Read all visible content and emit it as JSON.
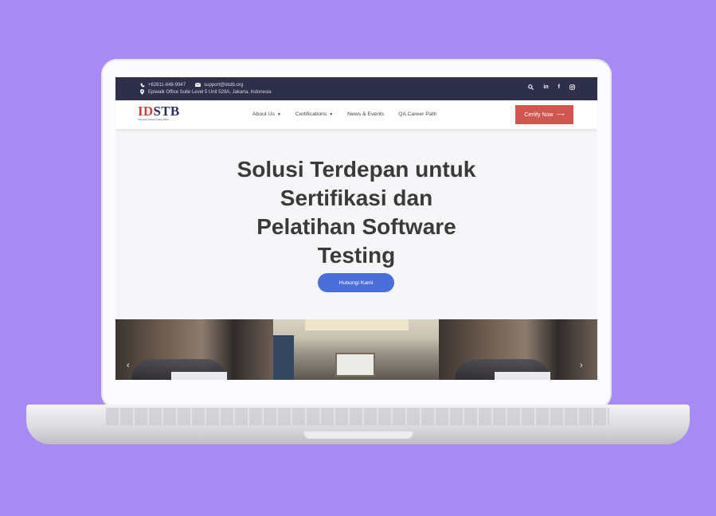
{
  "topbar": {
    "phone": "+62811-848-9947",
    "email": "support@idstb.org",
    "address": "Epiwalk Office Suite Level 5 Unit 529A, Jakarta, Indonesia",
    "icons": [
      "phone-icon",
      "mail-icon",
      "location-icon",
      "search-icon",
      "linkedin-icon",
      "facebook-icon",
      "instagram-icon"
    ],
    "social_labels": {
      "linkedin": "in",
      "facebook": "f"
    }
  },
  "logo": {
    "id": "ID",
    "stb": "STB",
    "subtitle": "Indonesia Software Testing Board"
  },
  "nav": {
    "items": [
      {
        "label": "About Us",
        "dropdown": true
      },
      {
        "label": "Certifications",
        "dropdown": true
      },
      {
        "label": "News & Events",
        "dropdown": false
      },
      {
        "label": "QA Career Path",
        "dropdown": false
      }
    ],
    "cta_label": "Certify Now",
    "cta_arrow": "⟶"
  },
  "hero": {
    "title_lines": [
      "Solusi Terdepan untuk",
      "Sertifikasi dan",
      "Pelatihan Software",
      "Testing"
    ],
    "button_label": "Hubungi Kami"
  },
  "carousel": {
    "prev": "‹",
    "next": "›"
  },
  "colors": {
    "background": "#a88af5",
    "topbar": "#2e2f4a",
    "cta": "#d0564f",
    "hero_button": "#4b6fd9",
    "logo_red": "#d0433d",
    "logo_navy": "#2a3160"
  }
}
